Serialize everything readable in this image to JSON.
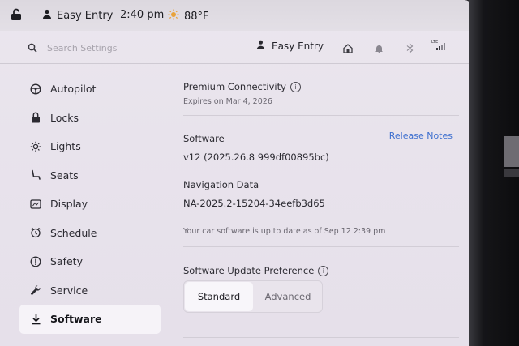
{
  "status_bar": {
    "profile_name": "Easy Entry",
    "time": "2:40 pm",
    "temperature": "88°F"
  },
  "header": {
    "search_placeholder": "Search Settings",
    "profile_name": "Easy Entry",
    "lte_label": "LTE"
  },
  "sidebar": {
    "items": [
      {
        "label": "Autopilot",
        "icon": "steering-wheel-icon"
      },
      {
        "label": "Locks",
        "icon": "lock-icon"
      },
      {
        "label": "Lights",
        "icon": "sun-icon"
      },
      {
        "label": "Seats",
        "icon": "seat-icon"
      },
      {
        "label": "Display",
        "icon": "display-icon"
      },
      {
        "label": "Schedule",
        "icon": "alarm-clock-icon"
      },
      {
        "label": "Safety",
        "icon": "alert-circle-icon"
      },
      {
        "label": "Service",
        "icon": "wrench-icon"
      },
      {
        "label": "Software",
        "icon": "download-icon"
      }
    ],
    "active": "Software"
  },
  "content": {
    "premium_title": "Premium Connectivity",
    "premium_expiry": "Expires on Mar 4, 2026",
    "software_label": "Software",
    "release_notes": "Release Notes",
    "software_version": "v12 (2025.26.8 999df00895bc)",
    "nav_label": "Navigation Data",
    "nav_version": "NA-2025.2-15204-34eefb3d65",
    "up_to_date": "Your car software is up to date as of Sep 12 2:39 pm",
    "update_pref_label": "Software Update Preference",
    "update_options": [
      "Standard",
      "Advanced"
    ],
    "update_selected": "Standard"
  },
  "colors": {
    "accent_link": "#3d6fcf",
    "sun": "#e8a33a"
  }
}
